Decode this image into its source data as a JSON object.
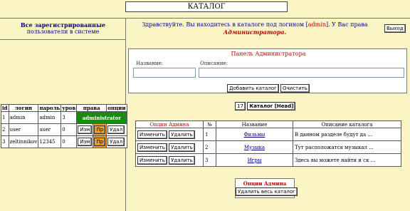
{
  "header": {
    "title": "КАТАЛОГ"
  },
  "left": {
    "heading_line1": "Все зарегистрированные",
    "heading_line2": "пользователи в системе",
    "columns": [
      "id",
      "логин",
      "пароль",
      "уров",
      "права",
      "опции"
    ],
    "admin_badge": "administrator",
    "users": [
      {
        "id": "1",
        "login": "admin",
        "password": "admin",
        "level": "3",
        "rights": ""
      },
      {
        "id": "2",
        "login": "user",
        "password": "user",
        "level": "0",
        "rights": ""
      },
      {
        "id": "3",
        "login": "zeltinnikov",
        "password": "12345",
        "level": "0",
        "rights": ""
      }
    ],
    "btn_edit": "Изм",
    "btn_rights": "Пр",
    "btn_delete": "Удал"
  },
  "greeting": {
    "pre": "Здравствуйте. Вы находитесь в каталоге под логином [",
    "login": "admin",
    "post": "]. У Вас права",
    "rights": "Администратора."
  },
  "exit_label": "Выход",
  "admin_panel": {
    "title": "Панель Администратора",
    "name_label": "Название:",
    "desc_label": "Описание:",
    "name_value": "",
    "desc_value": "",
    "add_button": "Добавить каталог",
    "clear_button": "Очистить"
  },
  "catalog_bar": {
    "count": "17",
    "label": "Каталог [Head]"
  },
  "catalogs": {
    "columns": [
      "Опции Админа",
      "№",
      "Название",
      "Описание каталога"
    ],
    "edit_label": "Изменить",
    "delete_label": "Удалить",
    "rows": [
      {
        "num": "1",
        "name": "Фильмы",
        "desc": "В данном разделе будут да ..."
      },
      {
        "num": "2",
        "name": "Музыка",
        "desc": "Тут расположатся музыкал ..."
      },
      {
        "num": "3",
        "name": "Игры",
        "desc": "Здесь вы можете найти и ск ..."
      }
    ]
  },
  "options": {
    "title": "Опции Админа",
    "delete_all": "Удалить весь каталог"
  },
  "colors": {
    "background": "#fbf5c6",
    "accent_red": "#c00000",
    "badge_green": "#1b8a12",
    "rights_orange": "#f0a020",
    "text_blue": "#000080"
  }
}
